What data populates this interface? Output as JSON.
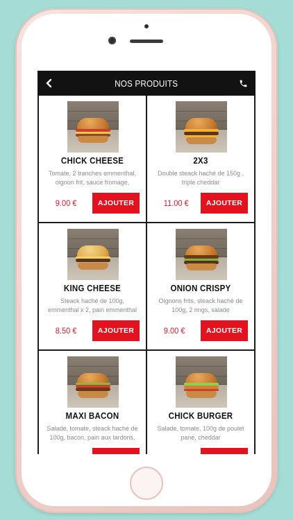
{
  "header": {
    "title": "NOS PRODUITS",
    "back_icon": "chevron-left-icon",
    "phone_icon": "phone-icon"
  },
  "colors": {
    "accent": "#e3121f",
    "price": "#d9182a",
    "navbar": "#121212"
  },
  "products": [
    {
      "name": "CHICK CHEESE",
      "description": "Tomate, 2 tranches emmenthal, oignon frit, sauce fromage, aiguillettes de",
      "price": "9.00 €",
      "button": "AJOUTER"
    },
    {
      "name": "2X3",
      "description": "Double steack haché de 150g , triple cheddar",
      "price": "11.00 €",
      "button": "AJOUTER"
    },
    {
      "name": "KING CHEESE",
      "description": "Steack haché de 100g, emmenthal x 2, pain emmenthal gratiné, sauce",
      "price": "8.50 €",
      "button": "AJOUTER"
    },
    {
      "name": "ONION CRISPY",
      "description": "Oignons frits, steack haché de 100g, 2 rings, salade",
      "price": "9.00 €",
      "button": "AJOUTER"
    },
    {
      "name": "MAXI BACON",
      "description": "Salade, tomate, steack haché de 100g, bacon, pain aux lardons, cheddar",
      "price": "",
      "button": ""
    },
    {
      "name": "CHICK BURGER",
      "description": "Salade, tomate, 100g de poulet pané, cheddar",
      "price": "",
      "button": ""
    }
  ]
}
